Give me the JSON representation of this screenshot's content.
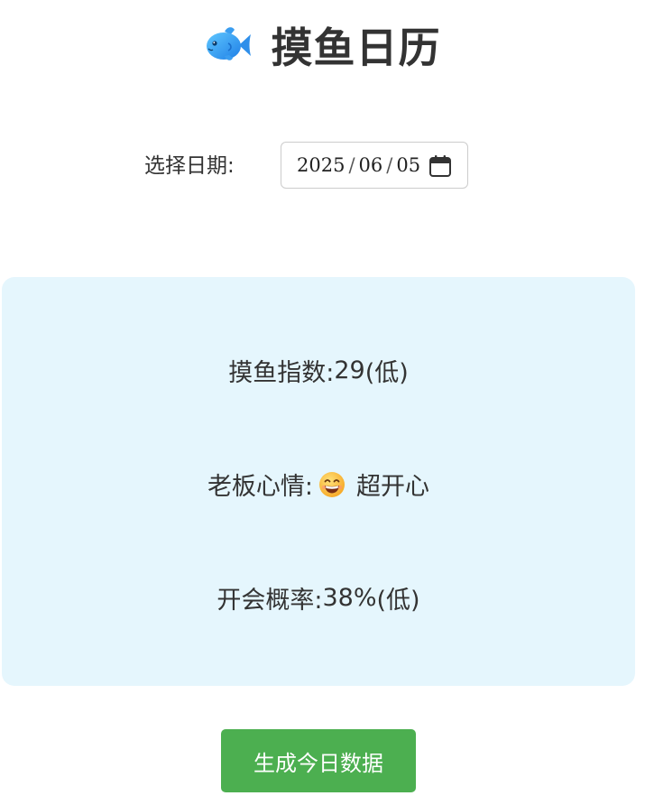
{
  "header": {
    "title": "摸鱼日历",
    "icon": "fish-icon"
  },
  "date_picker": {
    "label": "选择日期:",
    "year": "2025",
    "month": "06",
    "day": "05",
    "separator": "/",
    "icon": "calendar-icon"
  },
  "stats": {
    "fish_index": {
      "label": "摸鱼指数:",
      "value": "29",
      "level": "(低)"
    },
    "boss_mood": {
      "label": "老板心情:",
      "emoji_icon": "grinning-face-icon",
      "value": "超开心"
    },
    "meeting_probability": {
      "label": "开会概率:",
      "value": "38%",
      "level": "(低)"
    }
  },
  "actions": {
    "generate_label": "生成今日数据"
  },
  "colors": {
    "card_background": "#e5f6fd",
    "button_background": "#4caf50",
    "title_text": "#333333"
  }
}
